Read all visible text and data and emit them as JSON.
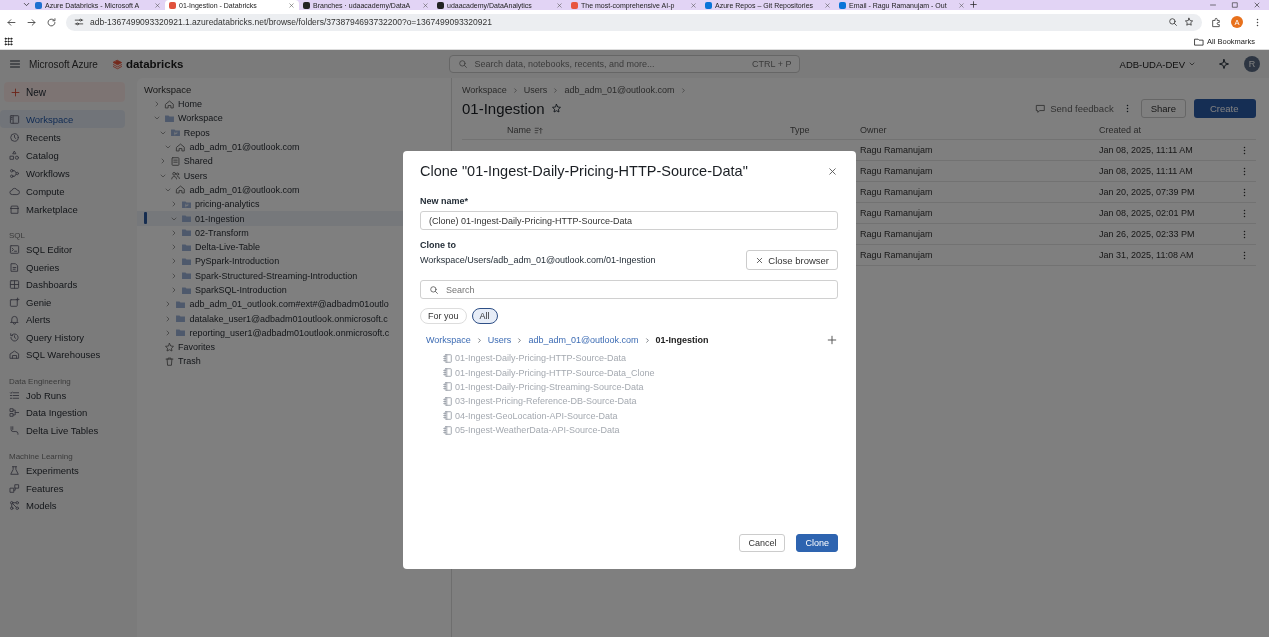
{
  "browser": {
    "tabs": [
      {
        "title": "Azure Databricks - Microsoft A",
        "selected": false
      },
      {
        "title": "01-Ingestion - Databricks",
        "selected": true
      },
      {
        "title": "Branches · udaacademy/DataA",
        "selected": false
      },
      {
        "title": "udaacademy/DataAnalytics",
        "selected": false
      },
      {
        "title": "The most-comprehensive AI-p",
        "selected": false
      },
      {
        "title": "Azure Repos – Git Repositories",
        "selected": false
      },
      {
        "title": "Email - Ragu Ramanujam - Out",
        "selected": false
      }
    ],
    "address": "adb-1367499093320921.1.azuredatabricks.net/browse/folders/3738794693732200?o=1367499093320921",
    "profile_initial": "A",
    "bookmarks_label": "All Bookmarks"
  },
  "header": {
    "brand": "Microsoft Azure",
    "logo_text": "databricks",
    "search_placeholder": "Search data, notebooks, recents, and more...",
    "shortcut": "CTRL + P",
    "workspace_name": "ADB-UDA-DEV",
    "avatar": "R"
  },
  "sidebar": {
    "new_button": "New",
    "sections": [
      {
        "items": [
          {
            "label": "Workspace",
            "selected": true
          },
          {
            "label": "Recents",
            "selected": false
          },
          {
            "label": "Catalog",
            "selected": false
          },
          {
            "label": "Workflows",
            "selected": false
          },
          {
            "label": "Compute",
            "selected": false
          },
          {
            "label": "Marketplace",
            "selected": false
          }
        ]
      },
      {
        "title": "SQL",
        "items": [
          {
            "label": "SQL Editor",
            "selected": false
          },
          {
            "label": "Queries",
            "selected": false
          },
          {
            "label": "Dashboards",
            "selected": false
          },
          {
            "label": "Genie",
            "selected": false
          },
          {
            "label": "Alerts",
            "selected": false
          },
          {
            "label": "Query History",
            "selected": false
          },
          {
            "label": "SQL Warehouses",
            "selected": false
          }
        ]
      },
      {
        "title": "Data Engineering",
        "items": [
          {
            "label": "Job Runs",
            "selected": false
          },
          {
            "label": "Data Ingestion",
            "selected": false
          },
          {
            "label": "Delta Live Tables",
            "selected": false
          }
        ]
      },
      {
        "title": "Machine Learning",
        "items": [
          {
            "label": "Experiments",
            "selected": false
          },
          {
            "label": "Features",
            "selected": false
          },
          {
            "label": "Models",
            "selected": false
          }
        ]
      }
    ]
  },
  "tree": {
    "title": "Workspace",
    "items": [
      {
        "label": "Home",
        "kind": "home",
        "expanded": false,
        "selected": false
      },
      {
        "label": "Workspace",
        "kind": "folder",
        "expanded": true,
        "selected": false,
        "children": [
          {
            "label": "Repos",
            "kind": "repo",
            "expanded": true,
            "selected": false,
            "children": [
              {
                "label": "adb_adm_01@outlook.com",
                "kind": "home",
                "expanded": true,
                "selected": false
              }
            ]
          },
          {
            "label": "Shared",
            "kind": "shared",
            "expanded": false,
            "selected": false
          },
          {
            "label": "Users",
            "kind": "users",
            "expanded": true,
            "selected": false,
            "children": [
              {
                "label": "adb_adm_01@outlook.com",
                "kind": "home",
                "expanded": true,
                "selected": false,
                "children": [
                  {
                    "label": "pricing-analytics",
                    "kind": "repo",
                    "expanded": false,
                    "selected": false
                  },
                  {
                    "label": "01-Ingestion",
                    "kind": "folder",
                    "expanded": true,
                    "selected": true
                  },
                  {
                    "label": "02-Transform",
                    "kind": "folder",
                    "expanded": false,
                    "selected": false
                  },
                  {
                    "label": "Delta-Live-Table",
                    "kind": "folder",
                    "expanded": false,
                    "selected": false
                  },
                  {
                    "label": "PySpark-Introduction",
                    "kind": "folder",
                    "expanded": false,
                    "selected": false
                  },
                  {
                    "label": "Spark-Structured-Streaming-Introduction",
                    "kind": "folder",
                    "expanded": false,
                    "selected": false
                  },
                  {
                    "label": "SparkSQL-Introduction",
                    "kind": "folder",
                    "expanded": false,
                    "selected": false
                  }
                ]
              },
              {
                "label": "adb_adm_01_outlook.com#ext#@adbadm01outlo",
                "kind": "folder",
                "expanded": false,
                "selected": false
              },
              {
                "label": "datalake_user1@adbadm01outlook.onmicrosoft.c",
                "kind": "folder",
                "expanded": false,
                "selected": false
              },
              {
                "label": "reporting_user1@adbadm01outlook.onmicrosoft.c",
                "kind": "folder",
                "expanded": false,
                "selected": false
              }
            ]
          }
        ]
      },
      {
        "label": "Favorites",
        "kind": "star",
        "selected": false
      },
      {
        "label": "Trash",
        "kind": "trash",
        "selected": false
      }
    ]
  },
  "main": {
    "breadcrumb": [
      "Workspace",
      "Users",
      "adb_adm_01@outlook.com"
    ],
    "title": "01-Ingestion",
    "feedback": "Send feedback",
    "share": "Share",
    "create": "Create",
    "table": {
      "columns": [
        "Name",
        "Type",
        "Owner",
        "Created at"
      ],
      "rows": [
        {
          "owner": "Ragu Ramanujam",
          "created_at": "Jan 08, 2025, 11:11 AM"
        },
        {
          "owner": "Ragu Ramanujam",
          "created_at": "Jan 08, 2025, 11:11 AM"
        },
        {
          "owner": "Ragu Ramanujam",
          "created_at": "Jan 20, 2025, 07:39 PM"
        },
        {
          "owner": "Ragu Ramanujam",
          "created_at": "Jan 08, 2025, 02:01 PM"
        },
        {
          "owner": "Ragu Ramanujam",
          "created_at": "Jan 26, 2025, 02:33 PM"
        },
        {
          "owner": "Ragu Ramanujam",
          "created_at": "Jan 31, 2025, 11:08 AM"
        }
      ]
    }
  },
  "dialog": {
    "title": "Clone \"01-Ingest-Daily-Pricing-HTTP-Source-Data\"",
    "name_label": "New name*",
    "name_value": "(Clone) 01-Ingest-Daily-Pricing-HTTP-Source-Data",
    "clone_to_label": "Clone to",
    "clone_to_path": "Workspace/Users/adb_adm_01@outlook.com/01-Ingestion",
    "close_browser": "Close browser",
    "search_placeholder": "Search",
    "filters": [
      {
        "label": "For you",
        "selected": false
      },
      {
        "label": "All",
        "selected": true
      }
    ],
    "breadcrumb": [
      "Workspace",
      "Users",
      "adb_adm_01@outlook.com",
      "01-Ingestion"
    ],
    "items": [
      {
        "label": "01-Ingest-Daily-Pricing-HTTP-Source-Data",
        "disabled": true
      },
      {
        "label": "01-Ingest-Daily-Pricing-HTTP-Source-Data_Clone",
        "disabled": true
      },
      {
        "label": "01-Ingest-Daily-Pricing-Streaming-Source-Data",
        "disabled": true
      },
      {
        "label": "03-Ingest-Pricing-Reference-DB-Source-Data",
        "disabled": true
      },
      {
        "label": "04-Ingest-GeoLocation-API-Source-Data",
        "disabled": true
      },
      {
        "label": "05-Ingest-WeatherData-API-Source-Data",
        "disabled": true
      }
    ],
    "buttons": [
      {
        "label": "Cancel",
        "kind": "secondary"
      },
      {
        "label": "Clone",
        "kind": "primary"
      }
    ]
  }
}
